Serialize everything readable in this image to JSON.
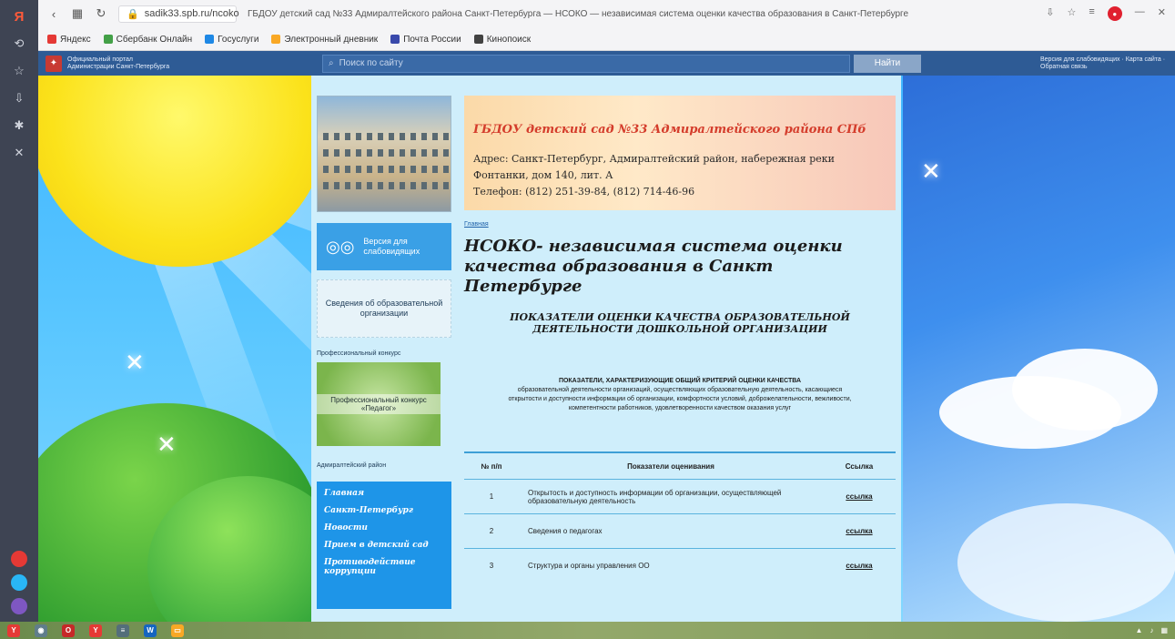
{
  "browser": {
    "url": "sadik33.spb.ru/ncoko",
    "page_title": "ГБДОУ детский сад №33 Адмиралтейского района Санкт-Петербурга — НСОКО — независимая система оценки качества образования в Санкт-Петербурге",
    "bookmarks": [
      {
        "label": "Яндекс",
        "color": "#e53935"
      },
      {
        "label": "Сбербанк Онлайн",
        "color": "#43a047"
      },
      {
        "label": "Госуслуги",
        "color": "#1e88e5"
      },
      {
        "label": "Электронный дневник",
        "color": "#f9a825"
      },
      {
        "label": "Почта России",
        "color": "#3949ab"
      },
      {
        "label": "Кинопоиск",
        "color": "#424242"
      }
    ]
  },
  "govbar": {
    "left_text": "Официальный портал Администрации Санкт-Петербурга",
    "search_placeholder": "Поиск по сайту",
    "find_label": "Найти",
    "right_text": "Версия для слабовидящих · Карта сайта · Обратная связь"
  },
  "sidebar": {
    "vision_label": "Версия для слабовидящих",
    "info_label": "Сведения об образовательной организации",
    "pc_label": "Профессиональный конкурс",
    "pc_image_text": "Профессиональный конкурс «Педагог»",
    "pc_footer": "Адмиралтейский район",
    "menu": [
      "Главная",
      "Санкт-Петербург",
      "Новости",
      "Прием в детский сад",
      "Противодействие коррупции"
    ]
  },
  "banner": {
    "title": "ГБДОУ детский сад №33 Адмиралтейского района СПб",
    "address": "Адрес: Санкт-Петербург, Адмиралтейский район, набережная реки Фонтанки, дом 140, лит. А",
    "phone": "Телефон: (812) 251-39-84, (812) 714-46-96"
  },
  "content": {
    "breadcrumb": "Главная",
    "heading": "НСОКО- независимая система оценки качества образования в Санкт Петербурге",
    "subheading": "ПОКАЗАТЕЛИ ОЦЕНКИ КАЧЕСТВА ОБРАЗОВАТЕЛЬНОЙ ДЕЯТЕЛЬНОСТИ ДОШКОЛЬНОЙ ОРГАНИЗАЦИИ",
    "intro_title": "ПОКАЗАТЕЛИ, ХАРАКТЕРИЗУЮЩИЕ ОБЩИЙ КРИТЕРИЙ ОЦЕНКИ КАЧЕСТВА",
    "intro_body": "образовательной деятельности организаций, осуществляющих образовательную деятельность, касающиеся открытости и доступности информации об организации, комфортности условий, доброжелательности, вежливости, компетентности работников, удовлетворенности качеством оказания услуг",
    "table": {
      "headers": [
        "№ п/п",
        "Показатели оценивания",
        "Ссылка"
      ],
      "rows": [
        {
          "num": "1",
          "name": "Открытость и доступность информации об организации, осуществляющей образовательную деятельность",
          "link": "ссылка"
        },
        {
          "num": "2",
          "name": "Сведения о педагогах",
          "link": "ссылка"
        },
        {
          "num": "3",
          "name": "Структура и органы управления ОО",
          "link": "ссылка"
        }
      ]
    }
  },
  "colors": {
    "menu_bg": "#1e95e8",
    "banner_title": "#d43c2b",
    "gov_bar": "#2e5b95"
  }
}
